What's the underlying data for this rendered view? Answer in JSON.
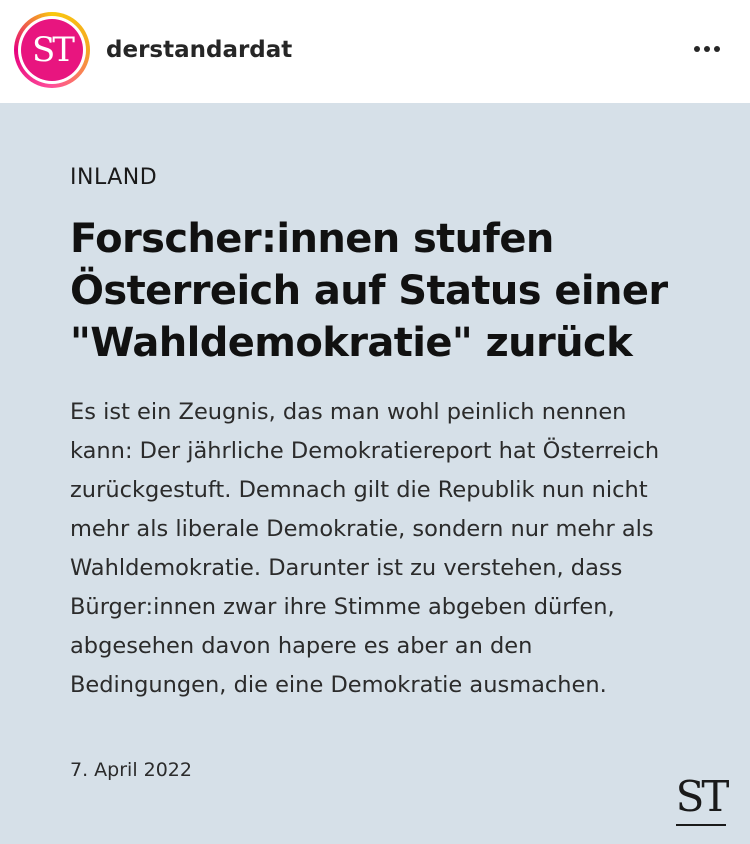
{
  "profile": {
    "username": "derstandardat",
    "avatar_text": "ST"
  },
  "post": {
    "section": "INLAND",
    "headline": "Forscher:innen stufen Österreich auf Status einer \"Wahldemokratie\" zurück",
    "body": "Es ist ein Zeugnis, das man wohl peinlich nennen kann: Der jährliche Demokratiereport hat Österreich zurückgestuft. Demnach gilt die Republik nun nicht mehr als liberale Demokratie, sondern nur mehr als Wahldemokratie. Darunter ist zu verstehen, dass Bürger:innen zwar ihre Stimme abgeben dürfen, abgesehen davon hapere es aber an den Bedingungen, die eine Demokratie ausmachen.",
    "date": "7. April 2022",
    "brand_mark": "ST"
  },
  "colors": {
    "post_background": "#d6e0e8",
    "brand_pink": "#e8157f",
    "text_dark": "#111111"
  },
  "icons": {
    "more": "more-horizontal-icon"
  }
}
